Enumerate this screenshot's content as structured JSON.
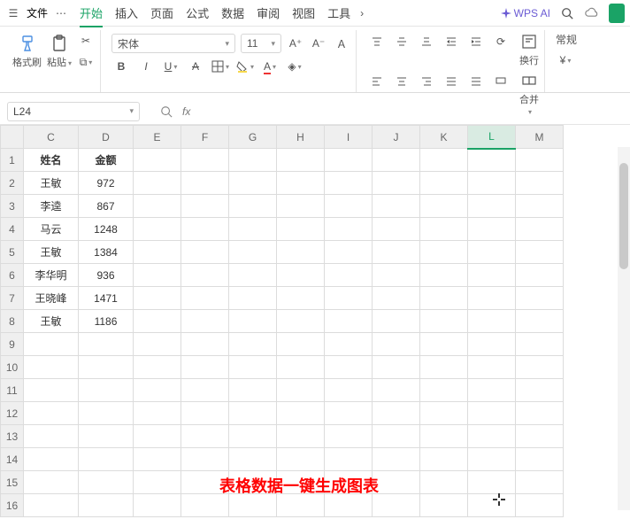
{
  "topbar": {
    "file_label": "文件",
    "menus": [
      {
        "label": "开始",
        "active": true
      },
      {
        "label": "插入"
      },
      {
        "label": "页面"
      },
      {
        "label": "公式"
      },
      {
        "label": "数据"
      },
      {
        "label": "审阅"
      },
      {
        "label": "视图"
      },
      {
        "label": "工具"
      }
    ],
    "ai_label": "WPS AI"
  },
  "ribbon": {
    "format_painter": "格式刷",
    "paste": "粘贴",
    "font_name": "宋体",
    "font_size": "11",
    "wrap": "换行",
    "merge": "合并",
    "style_label": "常规"
  },
  "cellbar": {
    "ref": "L24",
    "fx": "fx"
  },
  "grid": {
    "columns": [
      "C",
      "D",
      "E",
      "F",
      "G",
      "H",
      "I",
      "J",
      "K",
      "L",
      "M"
    ],
    "selected_col": "L",
    "row_count": 16,
    "headers": {
      "name": "姓名",
      "amount": "金额"
    },
    "data": [
      {
        "name": "王敏",
        "amount": "972"
      },
      {
        "name": "李逵",
        "amount": "867"
      },
      {
        "name": "马云",
        "amount": "1248"
      },
      {
        "name": "王敏",
        "amount": "1384"
      },
      {
        "name": "李华明",
        "amount": "936"
      },
      {
        "name": "王晓峰",
        "amount": "1471"
      },
      {
        "name": "王敏",
        "amount": "1186"
      }
    ]
  },
  "overlay": {
    "promo_text": "表格数据一键生成图表"
  }
}
